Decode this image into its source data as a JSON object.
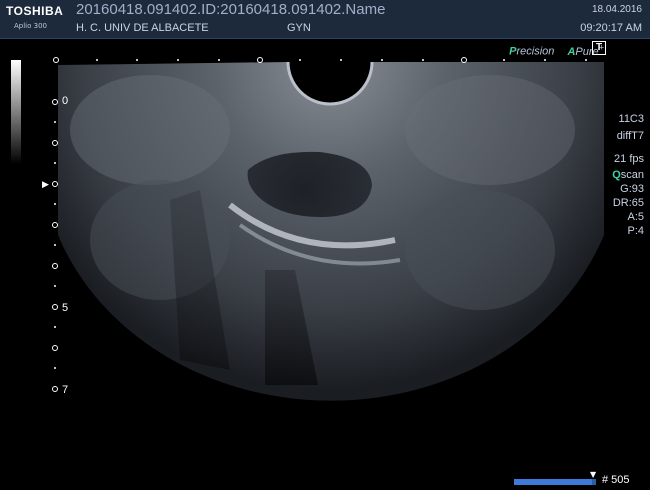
{
  "header": {
    "brand": "TOSHIBA",
    "model": "Aplio 300",
    "study": "20160418.091402.ID:20160418.091402.Name",
    "hospital": "H. C. UNIV DE ALBACETE",
    "department": "GYN",
    "date": "18.04.2016",
    "time": "09:20:17 AM"
  },
  "modes": {
    "precision_prefix": "P",
    "precision_rest": "recision",
    "apure_prefix": "A",
    "apure_rest": "Pure",
    "apure_sup": "+",
    "t_button": "T"
  },
  "params": {
    "probe": "11C3",
    "preset": "diffT7",
    "fps": "21 fps",
    "qscan_prefix": "Q",
    "qscan_rest": "scan",
    "gain": "G:93",
    "dynamic_range": "DR:65",
    "a": "A:5",
    "p": "P:4"
  },
  "depth_scale": {
    "label_0": "0",
    "label_5": "5",
    "label_7": "7"
  },
  "cine": {
    "frame": "# 505",
    "marker": "▼",
    "position": 0.95
  },
  "focus_marker": "▶",
  "colors": {
    "header_bg": "#1d2a3c",
    "accent_green": "#3fcf9c",
    "cine_bar": "#2a5fa8"
  }
}
